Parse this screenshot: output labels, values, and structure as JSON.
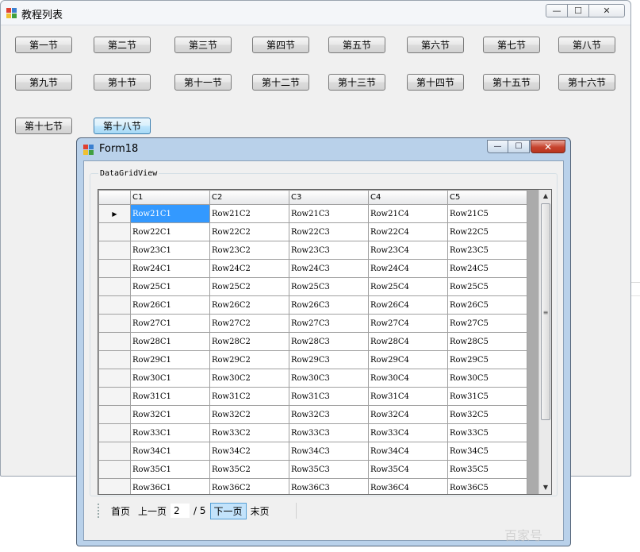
{
  "main_window": {
    "title": "教程列表",
    "buttons": [
      "第一节",
      "第二节",
      "第三节",
      "第四节",
      "第五节",
      "第六节",
      "第七节",
      "第八节",
      "第九节",
      "第十节",
      "第十一节",
      "第十二节",
      "第十三节",
      "第十四节",
      "第十五节",
      "第十六节",
      "第十七节",
      "第十八节"
    ],
    "focused_button": "第十八节"
  },
  "child_window": {
    "title": "Form18",
    "close_symbol": "✕",
    "group_label": "DataGridView",
    "columns": [
      "C1",
      "C2",
      "C3",
      "C4",
      "C5"
    ],
    "rows": [
      [
        "Row21C1",
        "Row21C2",
        "Row21C3",
        "Row21C4",
        "Row21C5"
      ],
      [
        "Row22C1",
        "Row22C2",
        "Row22C3",
        "Row22C4",
        "Row22C5"
      ],
      [
        "Row23C1",
        "Row23C2",
        "Row23C3",
        "Row23C4",
        "Row23C5"
      ],
      [
        "Row24C1",
        "Row24C2",
        "Row24C3",
        "Row24C4",
        "Row24C5"
      ],
      [
        "Row25C1",
        "Row25C2",
        "Row25C3",
        "Row25C4",
        "Row25C5"
      ],
      [
        "Row26C1",
        "Row26C2",
        "Row26C3",
        "Row26C4",
        "Row26C5"
      ],
      [
        "Row27C1",
        "Row27C2",
        "Row27C3",
        "Row27C4",
        "Row27C5"
      ],
      [
        "Row28C1",
        "Row28C2",
        "Row28C3",
        "Row28C4",
        "Row28C5"
      ],
      [
        "Row29C1",
        "Row29C2",
        "Row29C3",
        "Row29C4",
        "Row29C5"
      ],
      [
        "Row30C1",
        "Row30C2",
        "Row30C3",
        "Row30C4",
        "Row30C5"
      ],
      [
        "Row31C1",
        "Row31C2",
        "Row31C3",
        "Row31C4",
        "Row31C5"
      ],
      [
        "Row32C1",
        "Row32C2",
        "Row32C3",
        "Row32C4",
        "Row32C5"
      ],
      [
        "Row33C1",
        "Row33C2",
        "Row33C3",
        "Row33C4",
        "Row33C5"
      ],
      [
        "Row34C1",
        "Row34C2",
        "Row34C3",
        "Row34C4",
        "Row34C5"
      ],
      [
        "Row35C1",
        "Row35C2",
        "Row35C3",
        "Row35C4",
        "Row35C5"
      ],
      [
        "Row36C1",
        "Row36C2",
        "Row36C3",
        "Row36C4",
        "Row36C5"
      ]
    ],
    "current_row_marker": "▶",
    "pager": {
      "first": "首页",
      "prev": "上一页",
      "page": "2",
      "separator": "/ 5",
      "next": "下一页",
      "last": "末页"
    }
  },
  "watermark": "百家号",
  "colors": {
    "selected_cell": "#3399ff",
    "child_frame": "#b9d1ea",
    "close_button": "#c7432e"
  }
}
